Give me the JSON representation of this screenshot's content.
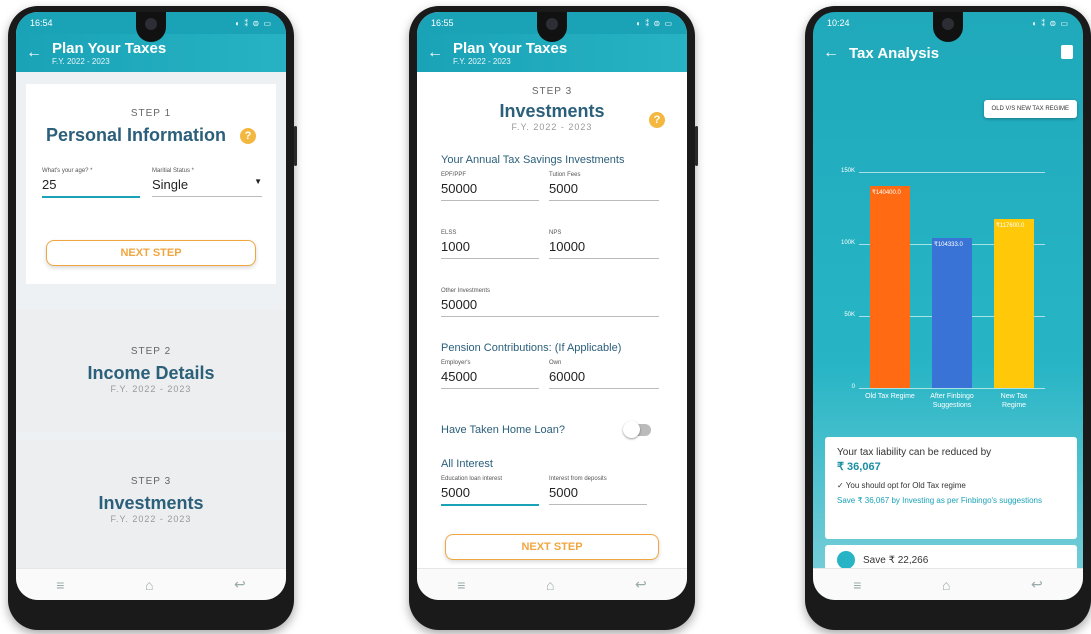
{
  "phone1": {
    "time": "16:54",
    "status_icons": "◐ ⁑ ⊜ ▭",
    "title": "Plan Your Taxes",
    "subtitle": "F.Y. 2022 - 2023",
    "step1": {
      "label": "STEP 1",
      "title": "Personal Information"
    },
    "age_label": "What's your age? *",
    "age_value": "25",
    "marital_label": "Maritial Status *",
    "marital_value": "Single",
    "next_label": "NEXT STEP",
    "step2": {
      "label": "STEP 2",
      "title": "Income Details",
      "year": "F.Y. 2022 - 2023"
    },
    "step3": {
      "label": "STEP 3",
      "title": "Investments",
      "year": "F.Y. 2022 - 2023"
    }
  },
  "phone2": {
    "time": "16:55",
    "status_icons": "◐ ⁑ ⊜ ▭",
    "title": "Plan Your Taxes",
    "subtitle": "F.Y. 2022 - 2023",
    "step_label": "STEP 3",
    "step_title": "Investments",
    "step_year": "F.Y. 2022 - 2023",
    "section1": "Your Annual Tax Savings Investments",
    "epf_label": "EPF/PPF",
    "epf_value": "50000",
    "tuition_label": "Tution Fees",
    "tuition_value": "5000",
    "elss_label": "ELSS",
    "elss_value": "1000",
    "nps_label": "NPS",
    "nps_value": "10000",
    "other_label": "Other Investments",
    "other_value": "50000",
    "section2": "Pension Contributions: (If Applicable)",
    "employer_label": "Employer's",
    "employer_value": "45000",
    "own_label": "Own",
    "own_value": "60000",
    "home_loan_label": "Have Taken Home Loan?",
    "section3": "All Interest",
    "edu_label": "Education loan interest",
    "edu_value": "5000",
    "deposit_label": "Interest from deposits",
    "deposit_value": "5000",
    "next_label": "NEXT STEP"
  },
  "phone3": {
    "time": "10:24",
    "status_icons": "◐ ⁑ ⊜ ▭",
    "title": "Tax Analysis",
    "toggle_label": "OLD V/S NEW TAX REGIME",
    "summary_line1": "Your tax liability can be reduced by",
    "summary_amount": "₹ 36,067",
    "summary_check": "✓ You should opt for Old Tax regime",
    "summary_save": "Save ₹ 36,067 by Investing as per Finbingo's suggestions",
    "next_card": "Save ₹ 22,266"
  },
  "chart_data": {
    "type": "bar",
    "categories": [
      "Old Tax Regime",
      "After Finbingo Suggestions",
      "New Tax Regime"
    ],
    "values": [
      140400,
      104333,
      117600
    ],
    "data_labels": [
      "₹140400.0",
      "₹104333.0",
      "₹117600.0"
    ],
    "colors": [
      "#ff6a13",
      "#3a73d6",
      "#ffc90a"
    ],
    "ylim": [
      0,
      150000
    ],
    "yticks": [
      0,
      50000,
      100000,
      150000
    ],
    "ytick_labels": [
      "0",
      "50K",
      "100K",
      "150K"
    ],
    "grid": true
  }
}
